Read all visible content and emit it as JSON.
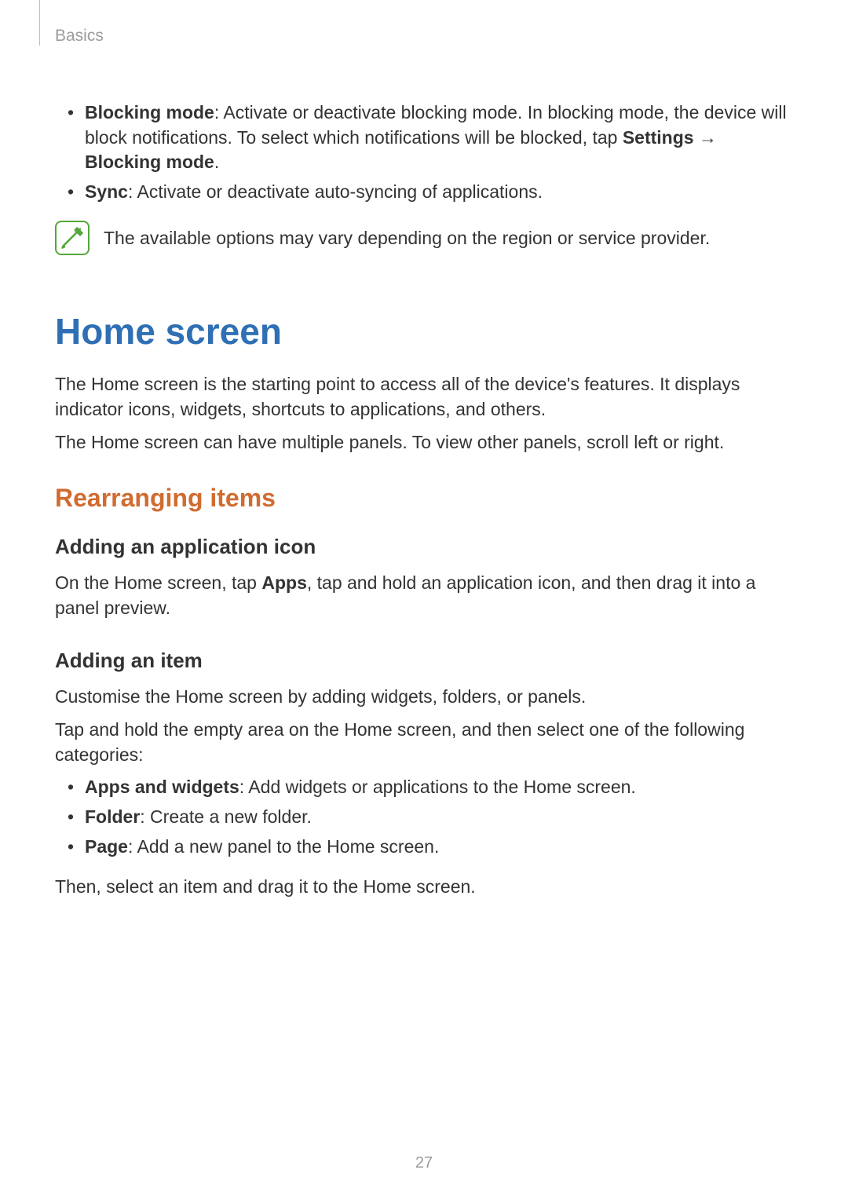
{
  "header": {
    "section": "Basics"
  },
  "top_bullets": [
    {
      "bold": "Blocking mode",
      "text1": ": Activate or deactivate blocking mode. In blocking mode, the device will block notifications. To select which notifications will be blocked, tap ",
      "bold2": "Settings",
      "arrow": " → ",
      "bold3": "Blocking mode",
      "text2": "."
    },
    {
      "bold": "Sync",
      "text1": ": Activate or deactivate auto-syncing of applications."
    }
  ],
  "note": "The available options may vary depending on the region or service provider.",
  "h1": "Home screen",
  "intro1": "The Home screen is the starting point to access all of the device's features. It displays indicator icons, widgets, shortcuts to applications, and others.",
  "intro2": "The Home screen can have multiple panels. To view other panels, scroll left or right.",
  "h2": "Rearranging items",
  "h3a": "Adding an application icon",
  "p_a_pre": "On the Home screen, tap ",
  "p_a_bold": "Apps",
  "p_a_post": ", tap and hold an application icon, and then drag it into a panel preview.",
  "h3b": "Adding an item",
  "p_b1": "Customise the Home screen by adding widgets, folders, or panels.",
  "p_b2": "Tap and hold the empty area on the Home screen, and then select one of the following categories:",
  "item_bullets": [
    {
      "bold": "Apps and widgets",
      "text": ": Add widgets or applications to the Home screen."
    },
    {
      "bold": "Folder",
      "text": ": Create a new folder."
    },
    {
      "bold": "Page",
      "text": ": Add a new panel to the Home screen."
    }
  ],
  "p_b3": "Then, select an item and drag it to the Home screen.",
  "page_number": "27"
}
